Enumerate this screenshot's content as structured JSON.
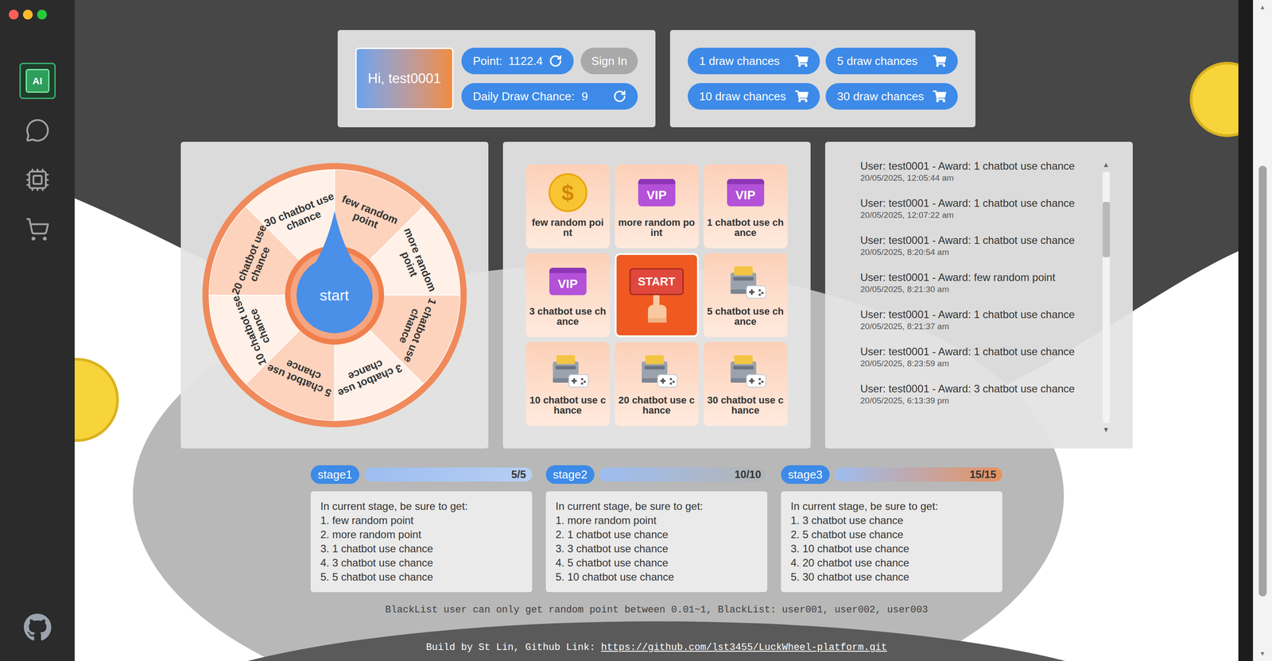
{
  "window": {
    "controls": [
      {
        "color": "#ff5f57"
      },
      {
        "color": "#febc2e"
      },
      {
        "color": "#28c840"
      }
    ]
  },
  "sidebar": {
    "items": [
      {
        "kind": "ai",
        "label": "AI",
        "selected": true
      },
      {
        "kind": "chat",
        "selected": false
      },
      {
        "kind": "chip",
        "selected": false
      },
      {
        "kind": "cart",
        "selected": false
      }
    ],
    "footer": {
      "kind": "github"
    }
  },
  "user": {
    "greeting": "Hi, test0001",
    "point_label": "Point:",
    "point_value": "1122.4",
    "sign_in": "Sign In",
    "daily_label": "Daily Draw Chance:",
    "daily_value": "9"
  },
  "purchases": [
    {
      "label": "1 draw chances"
    },
    {
      "label": "5 draw chances"
    },
    {
      "label": "10 draw chances"
    },
    {
      "label": "30 draw chances"
    }
  ],
  "wheel": {
    "start": "start",
    "segments": [
      {
        "label": "few random point",
        "color": "#fdd3bd"
      },
      {
        "label": "more random point",
        "color": "#fff1e8"
      },
      {
        "label": "1 chatbot use chance",
        "color": "#fdd3bd"
      },
      {
        "label": "3 chatbot use chance",
        "color": "#fff1e8"
      },
      {
        "label": "5 chatbot use chance",
        "color": "#fdd3bd"
      },
      {
        "label": "10 chatbot use chance",
        "color": "#fff1e8"
      },
      {
        "label": "20 chatbot use chance",
        "color": "#fdd3bd"
      },
      {
        "label": "30 chatbot use chance",
        "color": "#fff1e8"
      }
    ]
  },
  "grid": {
    "cells": [
      {
        "kind": "coin",
        "symbol": "$",
        "label": "few random point"
      },
      {
        "kind": "vip",
        "symbol": "VIP",
        "label": "more random point"
      },
      {
        "kind": "vip",
        "symbol": "VIP",
        "label": "1 chatbot use chance"
      },
      {
        "kind": "vip",
        "symbol": "VIP",
        "label": "3 chatbot use chance"
      },
      {
        "kind": "start",
        "symbol": "START"
      },
      {
        "kind": "console",
        "label": "5 chatbot use chance"
      },
      {
        "kind": "console",
        "label": "10 chatbot use chance"
      },
      {
        "kind": "console",
        "label": "20 chatbot use chance"
      },
      {
        "kind": "console",
        "label": "30 chatbot use chance"
      }
    ]
  },
  "records": {
    "items": [
      {
        "text": "User: test0001 - Award: 1 chatbot use chance",
        "time": "20/05/2025, 12:05:44 am"
      },
      {
        "text": "User: test0001 - Award: 1 chatbot use chance",
        "time": "20/05/2025, 12:07:22 am"
      },
      {
        "text": "User: test0001 - Award: 1 chatbot use chance",
        "time": "20/05/2025, 8:20:54 am"
      },
      {
        "text": "User: test0001 - Award: few random point",
        "time": "20/05/2025, 8:21:30 am"
      },
      {
        "text": "User: test0001 - Award: 1 chatbot use chance",
        "time": "20/05/2025, 8:21:37 am"
      },
      {
        "text": "User: test0001 - Award: 1 chatbot use chance",
        "time": "20/05/2025, 8:23:59 am"
      },
      {
        "text": "User: test0001 - Award: 3 chatbot use chance",
        "time": "20/05/2025, 6:13:39 pm"
      }
    ],
    "scroll": {
      "up": "▲",
      "down": "▼",
      "position": 0.12,
      "size": 0.22
    }
  },
  "stages": [
    {
      "label": "stage1",
      "progress": "5/5",
      "level": 1,
      "color": "#b7cff3",
      "heading": "In current stage, be sure to get:",
      "items": [
        "1. few random point",
        "2. more random point",
        "3. 1 chatbot use chance",
        "4. 3 chatbot use chance",
        "5. 5 chatbot use chance"
      ]
    },
    {
      "label": "stage2",
      "progress": "10/10",
      "level": 1,
      "color": "#b4b4b4",
      "heading": "In current stage, be sure to get:",
      "items": [
        "1. more random point",
        "2. 1 chatbot use chance",
        "3. 3 chatbot use chance",
        "4. 5 chatbot use chance",
        "5. 10 chatbot use chance"
      ]
    },
    {
      "label": "stage3",
      "progress": "15/15",
      "level": 1,
      "color": "#e8915e",
      "heading": "In current stage, be sure to get:",
      "items": [
        "1. 3 chatbot use chance",
        "2. 5 chatbot use chance",
        "3. 10 chatbot use chance",
        "4. 20 chatbot use chance",
        "5. 30 chatbot use chance"
      ]
    }
  ],
  "footer": {
    "blacklist": "BlackList user can only get random point between 0.01~1, BlackList: user001, user002, user003",
    "build_prefix": "Build by St Lin, Github Link: ",
    "build_link": "https://github.com/lst3455/LuckWheel-platform.git"
  },
  "page_scroll": {
    "up": "▲",
    "down": "▼",
    "position": 0.24,
    "size": 0.68
  }
}
